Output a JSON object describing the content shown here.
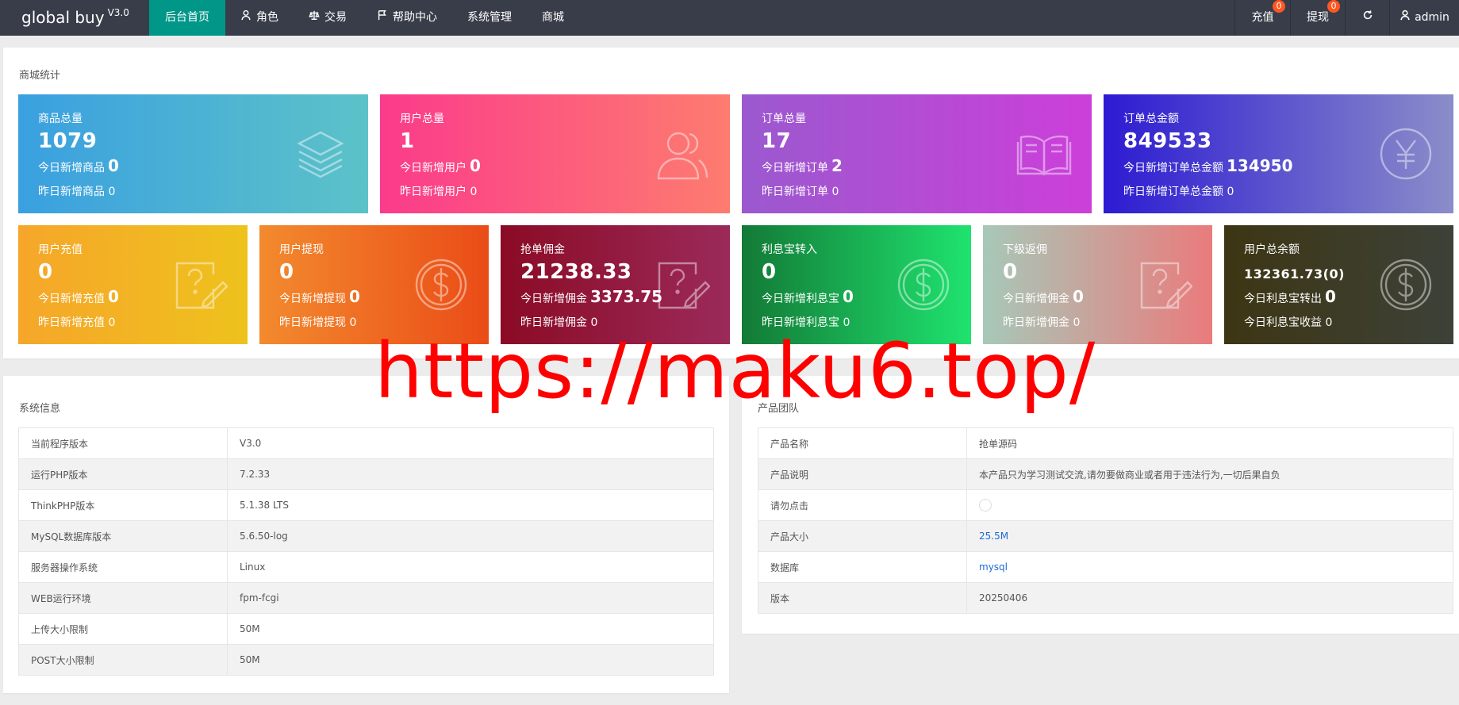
{
  "header": {
    "brand": "global buy",
    "version": "V3.0",
    "nav": [
      {
        "label": "后台首页",
        "icon": "",
        "active": true
      },
      {
        "label": "角色",
        "icon": "user-icon"
      },
      {
        "label": "交易",
        "icon": "scale-icon"
      },
      {
        "label": "帮助中心",
        "icon": "flag-icon"
      },
      {
        "label": "系统管理",
        "icon": ""
      },
      {
        "label": "商城",
        "icon": ""
      }
    ],
    "right": {
      "recharge_label": "充值",
      "recharge_badge": "0",
      "withdraw_label": "提现",
      "withdraw_badge": "0",
      "refresh_icon": "refresh-icon",
      "user_label": "admin"
    }
  },
  "stats": {
    "title": "商城统计",
    "cards": [
      {
        "title": "商品总量",
        "value": "1079",
        "today_label": "今日新增商品",
        "today_value": "0",
        "yest_label": "昨日新增商品",
        "yest_value": "0",
        "icon": "layers-icon",
        "color": "#3aa0e0"
      },
      {
        "title": "用户总量",
        "value": "1",
        "today_label": "今日新增用户",
        "today_value": "0",
        "yest_label": "昨日新增用户",
        "yest_value": "0",
        "icon": "users-icon",
        "color": "#fb3b8b"
      },
      {
        "title": "订单总量",
        "value": "17",
        "today_label": "今日新增订单",
        "today_value": "2",
        "yest_label": "昨日新增订单",
        "yest_value": "0",
        "icon": "book-icon",
        "color": "#9b59cf"
      },
      {
        "title": "订单总金额",
        "value": "849533",
        "today_label": "今日新增订单总金额",
        "today_value": "134950",
        "yest_label": "昨日新增订单总金额",
        "yest_value": "0",
        "icon": "yen-icon",
        "color": "#2c1bd2"
      },
      {
        "title": "用户充值",
        "value": "0",
        "today_label": "今日新增充值",
        "today_value": "0",
        "yest_label": "昨日新增充值",
        "yest_value": "0",
        "icon": "help-edit-icon",
        "color": "#f6a62a"
      },
      {
        "title": "用户提现",
        "value": "0",
        "today_label": "今日新增提现",
        "today_value": "0",
        "yest_label": "昨日新增提现",
        "yest_value": "0",
        "icon": "dollar-icon",
        "color": "#f38a2e"
      },
      {
        "title": "抢单佣金",
        "value": "21238.33",
        "today_label": "今日新增佣金",
        "today_value": "3373.75",
        "yest_label": "昨日新增佣金",
        "yest_value": "0",
        "icon": "help-edit-icon",
        "color": "#8b0b25"
      },
      {
        "title": "利息宝转入",
        "value": "0",
        "today_label": "今日新增利息宝",
        "today_value": "0",
        "yest_label": "昨日新增利息宝",
        "yest_value": "0",
        "icon": "dollar-icon",
        "color": "#137a36"
      },
      {
        "title": "下级返佣",
        "value": "0",
        "today_label": "今日新增佣金",
        "today_value": "0",
        "yest_label": "昨日新增佣金",
        "yest_value": "0",
        "icon": "help-edit-icon",
        "color": "#a7c8b8"
      },
      {
        "title": "用户总余额",
        "value": "132361.73(0)",
        "today_label": "今日利息宝转出",
        "today_value": "0",
        "yest_label": "今日利息宝收益",
        "yest_value": "0",
        "icon": "dollar-icon",
        "color": "#3d3614"
      }
    ]
  },
  "system_info": {
    "title": "系统信息",
    "rows": [
      {
        "label": "当前程序版本",
        "value": "V3.0"
      },
      {
        "label": "运行PHP版本",
        "value": "7.2.33"
      },
      {
        "label": "ThinkPHP版本",
        "value": "5.1.38 LTS"
      },
      {
        "label": "MySQL数据库版本",
        "value": "5.6.50-log"
      },
      {
        "label": "服务器操作系统",
        "value": "Linux"
      },
      {
        "label": "WEB运行环境",
        "value": "fpm-fcgi"
      },
      {
        "label": "上传大小限制",
        "value": "50M"
      },
      {
        "label": "POST大小限制",
        "value": "50M"
      }
    ]
  },
  "product_team": {
    "title": "产品团队",
    "rows": [
      {
        "label": "产品名称",
        "value": "抢单源码"
      },
      {
        "label": "产品说明",
        "value": "本产品只为学习测试交流,请勿要做商业或者用于违法行为,一切后果自负"
      },
      {
        "label": "请勿点击",
        "value": ""
      },
      {
        "label": "产品大小",
        "value": "25.5M"
      },
      {
        "label": "数据库",
        "value": "mysql"
      },
      {
        "label": "版本",
        "value": "20250406"
      }
    ]
  },
  "watermark": "https://maku6.top/"
}
